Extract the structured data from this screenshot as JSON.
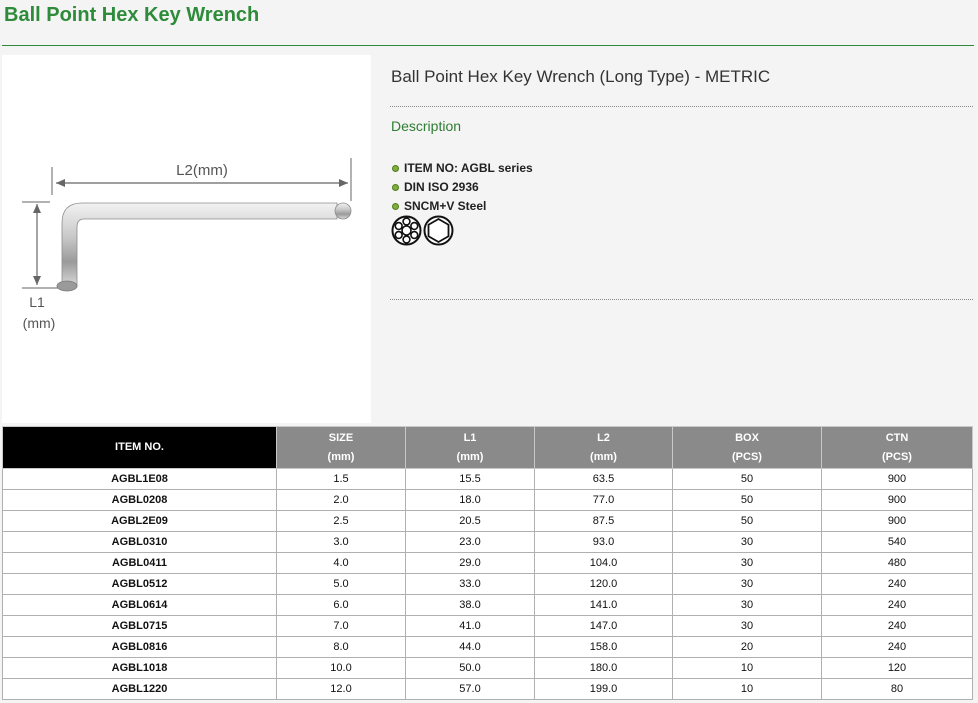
{
  "page": {
    "title": "Ball Point Hex Key Wrench"
  },
  "product": {
    "subtitle": "Ball Point Hex Key Wrench (Long Type) - METRIC",
    "description_heading": "Description",
    "bullets": [
      "ITEM NO: AGBL series",
      "DIN ISO 2936",
      "SNCM+V Steel"
    ],
    "icons": [
      "torx-socket-icon",
      "hexagon-socket-icon"
    ]
  },
  "diagram": {
    "l2_label": "L2(mm)",
    "l1_label": "L1",
    "l1_unit": "(mm)"
  },
  "table": {
    "headers": [
      {
        "top": "ITEM NO.",
        "bottom": ""
      },
      {
        "top": "SIZE",
        "bottom": "(mm)"
      },
      {
        "top": "L1",
        "bottom": "(mm)"
      },
      {
        "top": "L2",
        "bottom": "(mm)"
      },
      {
        "top": "BOX",
        "bottom": "(PCS)"
      },
      {
        "top": "CTN",
        "bottom": "(PCS)"
      }
    ],
    "rows": [
      [
        "AGBL1E08",
        "1.5",
        "15.5",
        "63.5",
        "50",
        "900"
      ],
      [
        "AGBL0208",
        "2.0",
        "18.0",
        "77.0",
        "50",
        "900"
      ],
      [
        "AGBL2E09",
        "2.5",
        "20.5",
        "87.5",
        "50",
        "900"
      ],
      [
        "AGBL0310",
        "3.0",
        "23.0",
        "93.0",
        "30",
        "540"
      ],
      [
        "AGBL0411",
        "4.0",
        "29.0",
        "104.0",
        "30",
        "480"
      ],
      [
        "AGBL0512",
        "5.0",
        "33.0",
        "120.0",
        "30",
        "240"
      ],
      [
        "AGBL0614",
        "6.0",
        "38.0",
        "141.0",
        "30",
        "240"
      ],
      [
        "AGBL0715",
        "7.0",
        "41.0",
        "147.0",
        "30",
        "240"
      ],
      [
        "AGBL0816",
        "8.0",
        "44.0",
        "158.0",
        "20",
        "240"
      ],
      [
        "AGBL1018",
        "10.0",
        "50.0",
        "180.0",
        "10",
        "120"
      ],
      [
        "AGBL1220",
        "12.0",
        "57.0",
        "199.0",
        "10",
        "80"
      ]
    ]
  },
  "colors": {
    "brand_green": "#2e8b3a",
    "header_gray": "#8a8a8a",
    "bullet_green": "#7fae3a"
  }
}
